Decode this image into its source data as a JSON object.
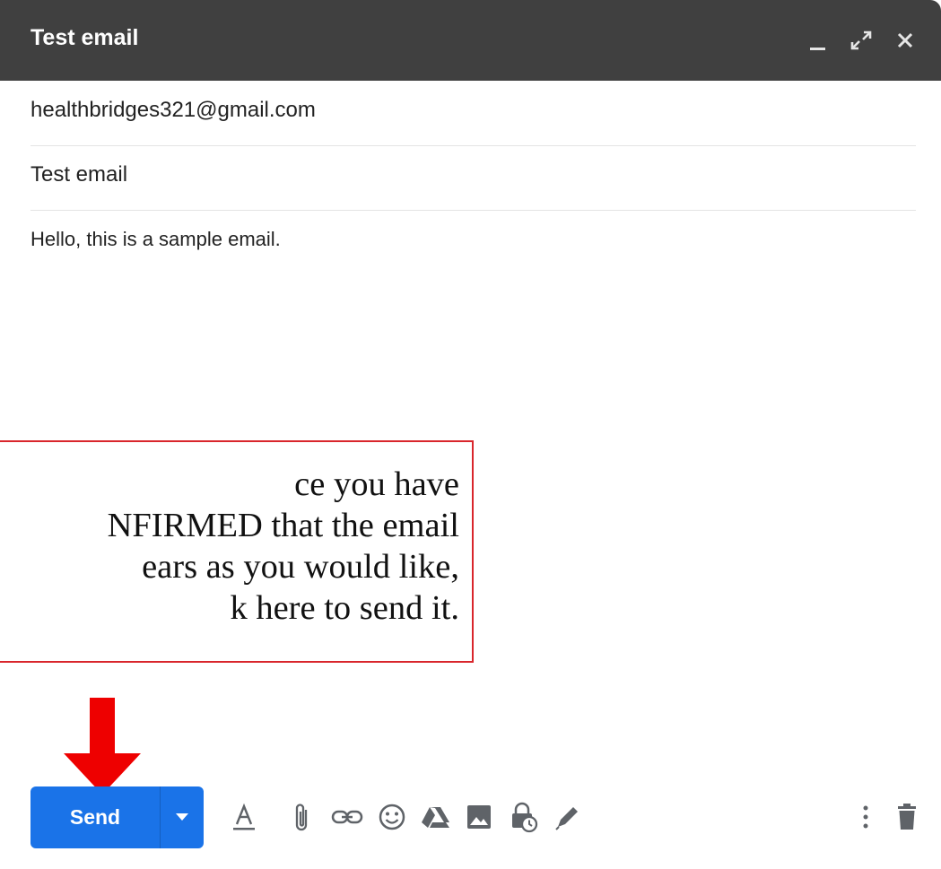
{
  "compose": {
    "title": "Test email",
    "to": "healthbridges321@gmail.com",
    "subject": "Test email",
    "body": "Hello, this is a sample email."
  },
  "window_controls": [
    {
      "name": "minimize-icon"
    },
    {
      "name": "expand-icon"
    },
    {
      "name": "close-icon"
    }
  ],
  "callout": {
    "lines": [
      "ce you have",
      "NFIRMED that the email",
      "ears as you would like,",
      "k here to send it."
    ],
    "border_color": "#d9262c"
  },
  "toolbar": {
    "send_label": "Send",
    "send_color": "#1a73e8",
    "icons": [
      "formatting-options-icon",
      "attach-file-icon",
      "insert-link-icon",
      "insert-emoji-icon",
      "google-drive-icon",
      "insert-photo-icon",
      "confidential-mode-icon",
      "signature-icon",
      "more-options-icon",
      "discard-draft-icon"
    ]
  },
  "annotation_arrow_color": "#ee0000"
}
